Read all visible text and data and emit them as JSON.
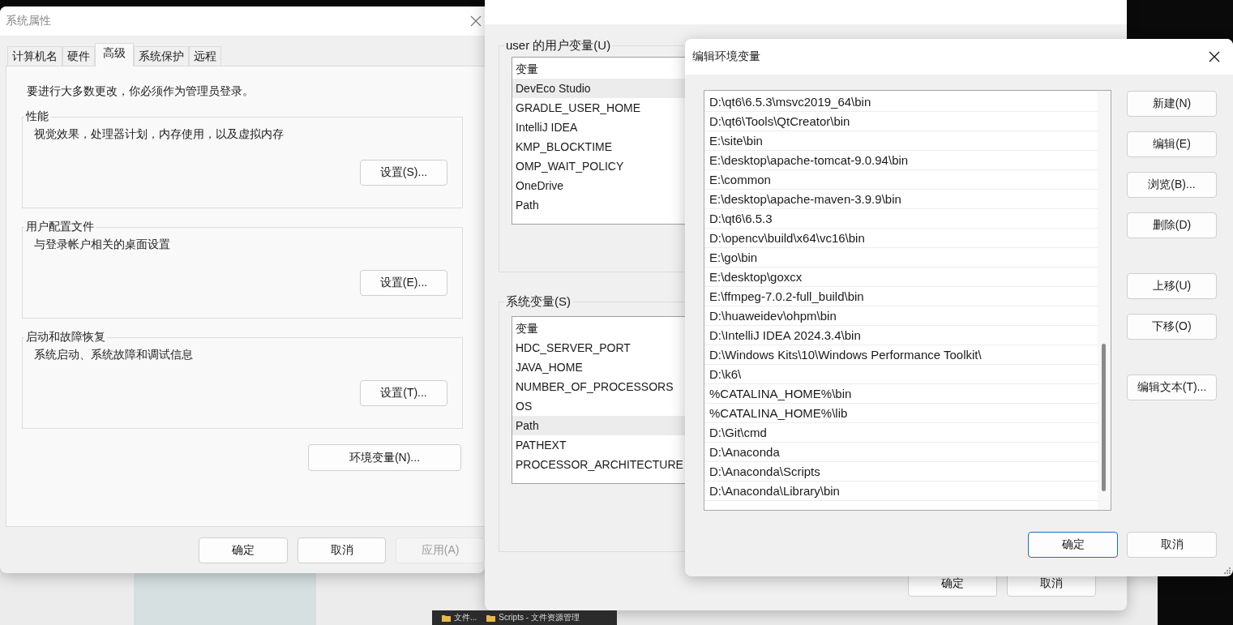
{
  "system_properties": {
    "title": "系统属性",
    "tabs": [
      {
        "label": "计算机名",
        "selected": false
      },
      {
        "label": "硬件",
        "selected": false
      },
      {
        "label": "高级",
        "selected": true
      },
      {
        "label": "系统保护",
        "selected": false
      },
      {
        "label": "远程",
        "selected": false
      }
    ],
    "notice": "要进行大多数更改，你必须作为管理员登录。",
    "groups": [
      {
        "title": "性能",
        "description": "视觉效果，处理器计划，内存使用，以及虚拟内存",
        "button": "设置(S)..."
      },
      {
        "title": "用户配置文件",
        "description": "与登录帐户相关的桌面设置",
        "button": "设置(E)..."
      },
      {
        "title": "启动和故障恢复",
        "description": "系统启动、系统故障和调试信息",
        "button": "设置(T)..."
      }
    ],
    "env_button": "环境变量(N)...",
    "buttons": [
      {
        "label": "确定",
        "disabled": false
      },
      {
        "label": "取消",
        "disabled": false
      },
      {
        "label": "应用(A)",
        "disabled": true
      }
    ]
  },
  "environment_variables": {
    "user_group": {
      "title": "user 的用户变量(U)",
      "header": "变量",
      "rows": [
        {
          "name": "DevEco Studio",
          "selected": true
        },
        {
          "name": "GRADLE_USER_HOME",
          "selected": false
        },
        {
          "name": "IntelliJ IDEA",
          "selected": false
        },
        {
          "name": "KMP_BLOCKTIME",
          "selected": false
        },
        {
          "name": "OMP_WAIT_POLICY",
          "selected": false
        },
        {
          "name": "OneDrive",
          "selected": false
        },
        {
          "name": "Path",
          "selected": false
        }
      ]
    },
    "system_group": {
      "title": "系统变量(S)",
      "header": "变量",
      "rows": [
        {
          "name": "HDC_SERVER_PORT",
          "selected": false
        },
        {
          "name": "JAVA_HOME",
          "selected": false
        },
        {
          "name": "NUMBER_OF_PROCESSORS",
          "selected": false
        },
        {
          "name": "OS",
          "selected": false
        },
        {
          "name": "Path",
          "selected": true
        },
        {
          "name": "PATHEXT",
          "selected": false
        },
        {
          "name": "PROCESSOR_ARCHITECTURE",
          "selected": false
        }
      ]
    },
    "buttons": [
      "确定",
      "取消"
    ]
  },
  "edit_dialog": {
    "title": "编辑环境变量",
    "paths": [
      "D:\\qt6\\6.5.3\\msvc2019_64\\bin",
      "D:\\qt6\\Tools\\QtCreator\\bin",
      "E:\\site\\bin",
      "E:\\desktop\\apache-tomcat-9.0.94\\bin",
      "E:\\common",
      "E:\\desktop\\apache-maven-3.9.9\\bin",
      "D:\\qt6\\6.5.3",
      "D:\\opencv\\build\\x64\\vc16\\bin",
      "E:\\go\\bin",
      "E:\\desktop\\goxcx",
      "E:\\ffmpeg-7.0.2-full_build\\bin",
      "D:\\huaweidev\\ohpm\\bin",
      "D:\\IntelliJ IDEA 2024.3.4\\bin",
      "D:\\Windows Kits\\10\\Windows Performance Toolkit\\",
      "D:\\k6\\",
      "%CATALINA_HOME%\\bin",
      "%CATALINA_HOME%\\lib",
      "D:\\Git\\cmd",
      "D:\\Anaconda",
      "D:\\Anaconda\\Scripts",
      "D:\\Anaconda\\Library\\bin"
    ],
    "side_buttons": [
      {
        "label": "新建(N)",
        "kind": "first"
      },
      {
        "label": "编辑(E)",
        "kind": "normal"
      },
      {
        "label": "浏览(B)...",
        "kind": "normal"
      },
      {
        "label": "删除(D)",
        "kind": "normal"
      },
      {
        "label": "上移(U)",
        "kind": "spaced"
      },
      {
        "label": "下移(O)",
        "kind": "normal"
      },
      {
        "label": "编辑文本(T)...",
        "kind": "far"
      }
    ],
    "buttons": [
      {
        "label": "确定",
        "default": true
      },
      {
        "label": "取消",
        "default": false
      }
    ]
  },
  "taskbar": [
    {
      "label": "文件..."
    },
    {
      "label": "Scripts - 文件资源管理"
    }
  ]
}
